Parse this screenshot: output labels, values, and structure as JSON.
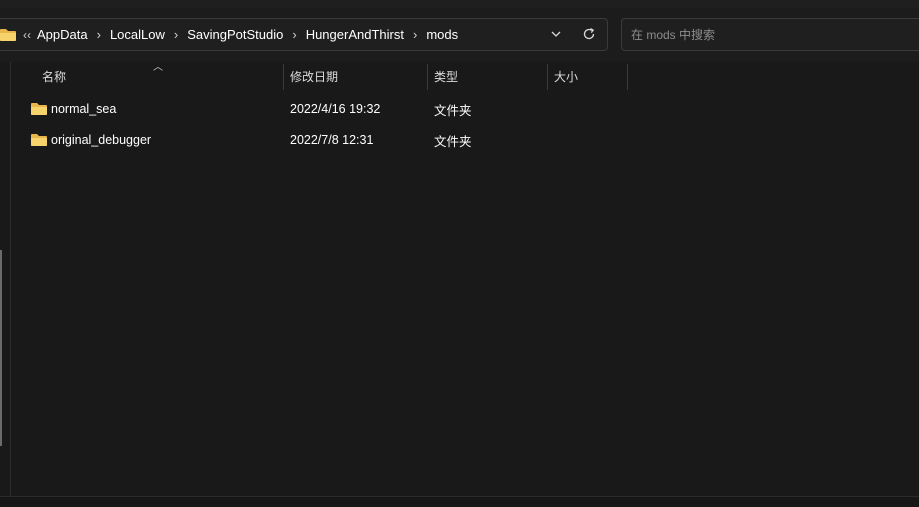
{
  "address_bar": {
    "overflow": "‹‹",
    "crumbs": [
      "AppData",
      "LocalLow",
      "SavingPotStudio",
      "HungerAndThirst",
      "mods"
    ]
  },
  "search": {
    "placeholder": "在 mods 中搜索"
  },
  "columns": {
    "name": "名称",
    "modified": "修改日期",
    "type": "类型",
    "size": "大小"
  },
  "files": [
    {
      "name": "normal_sea",
      "modified": "2022/4/16 19:32",
      "type": "文件夹",
      "size": ""
    },
    {
      "name": "original_debugger",
      "modified": "2022/7/8 12:31",
      "type": "文件夹",
      "size": ""
    }
  ],
  "colors": {
    "background": "#191919",
    "folder": "#f2c94c"
  }
}
